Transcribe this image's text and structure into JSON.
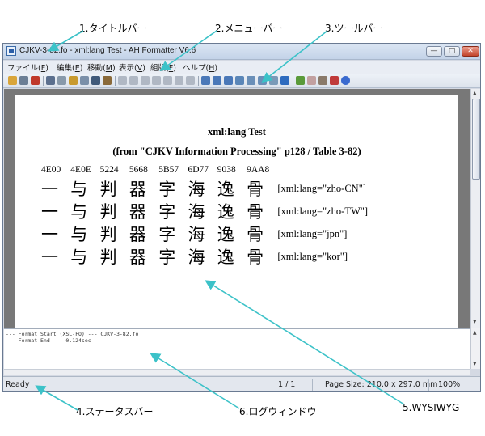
{
  "callouts": {
    "titlebar": "1.タイトルバー",
    "menubar": "2.メニューバー",
    "toolbar": "3.ツールバー",
    "statusbar": "4.ステータスバー",
    "wysiwyg": "5.WYSIWYG",
    "log": "6.ログウィンドウ"
  },
  "window": {
    "title": "CJKV-3-82.fo - xml:lang Test - AH Formatter V6.6",
    "buttons": {
      "minimize": "—",
      "maximize": "□",
      "close": "✕"
    }
  },
  "menu": [
    {
      "label": "ファイル",
      "key": "F"
    },
    {
      "label": "編集",
      "key": "E"
    },
    {
      "label": "移動",
      "key": "M"
    },
    {
      "label": "表示",
      "key": "V"
    },
    {
      "label": "組版",
      "key": "F"
    },
    {
      "label": "ヘルプ",
      "key": "H"
    }
  ],
  "toolbar_icons": [
    "open-icon",
    "print-icon",
    "pdf-icon",
    "select-icon",
    "copy-icon",
    "edit-icon",
    "edit2-icon",
    "find-icon",
    "binocular-icon",
    "first-page-icon",
    "prev-page-icon",
    "next-page-icon",
    "last-page-icon",
    "go-page-icon",
    "back-icon",
    "forward-icon",
    "zoom-in-icon",
    "zoom-out-icon",
    "zoom-fit-icon",
    "page-width-icon",
    "single-page-icon",
    "two-page-icon",
    "grid-icon",
    "g-icon",
    "run-icon",
    "stop-icon",
    "settings-icon",
    "pdf-out-icon",
    "help-icon"
  ],
  "document": {
    "title": "xml:lang Test",
    "subtitle": "(from \"CJKV Information Processing\" p128 / Table 3-82)",
    "codes": [
      "4E00",
      "4E0E",
      "5224",
      "5668",
      "5B57",
      "6D77",
      "9038",
      "9AA8"
    ],
    "chars": [
      "一",
      "与",
      "判",
      "器",
      "字",
      "海",
      "逸",
      "骨"
    ],
    "langs": [
      "[xml:lang=\"zho-CN\"]",
      "[xml:lang=\"zho-TW\"]",
      "[xml:lang=\"jpn\"]",
      "[xml:lang=\"kor\"]"
    ]
  },
  "log": [
    "--- Format Start (XSL-FO) --- CJKV-3-82.fo",
    "--- Format End ---  0.124sec"
  ],
  "status": {
    "ready": "Ready",
    "page": "1 / 1",
    "page_size": "Page Size: 210.0 x 297.0 mm",
    "zoom": "100%"
  }
}
